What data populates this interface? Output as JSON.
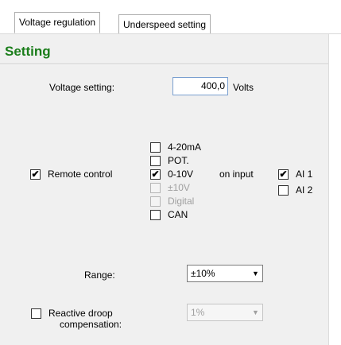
{
  "tabs": [
    {
      "label": "Voltage regulation",
      "active": true
    },
    {
      "label": "Underspeed setting",
      "active": false
    }
  ],
  "section": {
    "title": "Setting"
  },
  "voltage": {
    "label": "Voltage setting:",
    "value": "400,0",
    "unit": "Volts"
  },
  "remote_control": {
    "label": "Remote control",
    "checked": true,
    "options": [
      {
        "label": "4-20mA",
        "checked": false,
        "enabled": true
      },
      {
        "label": "POT.",
        "checked": false,
        "enabled": true
      },
      {
        "label": "0-10V",
        "checked": true,
        "enabled": true
      },
      {
        "label": "±10V",
        "checked": false,
        "enabled": false
      },
      {
        "label": "Digital",
        "checked": false,
        "enabled": false
      },
      {
        "label": "CAN",
        "checked": false,
        "enabled": true
      }
    ],
    "on_input_label": "on input",
    "inputs": [
      {
        "label": "AI 1",
        "checked": true
      },
      {
        "label": "AI 2",
        "checked": false
      }
    ]
  },
  "range": {
    "label": "Range:",
    "value": "±10%"
  },
  "reactive_droop": {
    "label_line1": "Reactive droop",
    "label_line2": "compensation:",
    "checked": false,
    "value": "1%"
  },
  "icons": {
    "checkmark": "✔",
    "dropdown": "▼"
  }
}
